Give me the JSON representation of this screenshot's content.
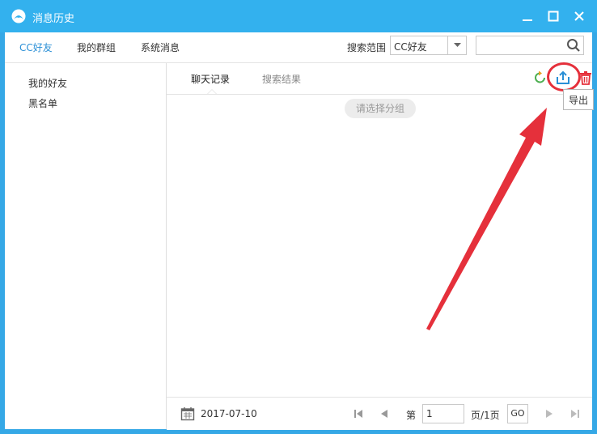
{
  "window": {
    "title": "消息历史"
  },
  "topbar": {
    "tabs": [
      "CC好友",
      "我的群组",
      "系统消息"
    ],
    "scope_label": "搜索范围",
    "scope_value": "CC好友",
    "search_value": ""
  },
  "sidebar": {
    "items": [
      "我的好友",
      "黑名单"
    ]
  },
  "content": {
    "tabs": [
      "聊天记录",
      "搜索结果"
    ],
    "group_hint": "请选择分组",
    "tooltip": "导出"
  },
  "bottom": {
    "date": "2017-07-10",
    "page_prefix": "第",
    "page_value": "1",
    "page_suffix": "页/1页",
    "go_label": "GO"
  },
  "colors": {
    "titlebar": "#33b1ee",
    "active_tab": "#2a8fd6",
    "annotation": "#e5303b"
  }
}
